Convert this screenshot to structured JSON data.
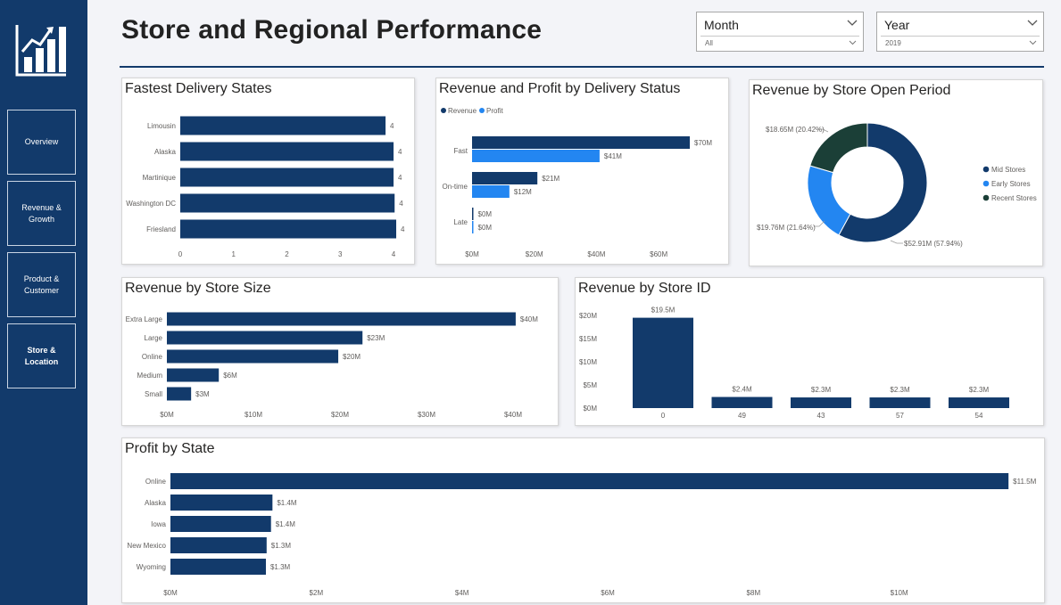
{
  "page": {
    "title": "Store and Regional Performance"
  },
  "colors": {
    "navy": "#123a6b",
    "blue": "#2386f1",
    "dark_green": "#1b3f37",
    "sidebar": "#123a6b"
  },
  "sidebar": {
    "logo_icon": "bar-chart-growth-icon",
    "items": [
      {
        "label": "Overview",
        "active": false
      },
      {
        "label": "Revenue & Growth",
        "active": false
      },
      {
        "label": "Product & Customer",
        "active": false
      },
      {
        "label": "Store & Location",
        "active": true
      }
    ]
  },
  "slicers": {
    "month": {
      "label": "Month",
      "value": "All"
    },
    "year": {
      "label": "Year",
      "value": "2019"
    }
  },
  "chart_data": [
    {
      "id": "fastest_delivery",
      "type": "bar",
      "orientation": "horizontal",
      "title": "Fastest Delivery States",
      "categories": [
        "Limousin",
        "Alaska",
        "Martinique",
        "Washington DC",
        "Friesland"
      ],
      "values": [
        3.85,
        4.0,
        4.0,
        4.02,
        4.05
      ],
      "data_labels": [
        "4",
        "4",
        "4",
        "4",
        "4"
      ],
      "xlim": [
        0,
        4.1
      ],
      "x_ticks": [
        "0",
        "1",
        "2",
        "3",
        "4"
      ]
    },
    {
      "id": "delivery_status",
      "type": "bar",
      "orientation": "horizontal",
      "title": "Revenue and Profit by Delivery Status",
      "categories": [
        "Fast",
        "On-time",
        "Late"
      ],
      "series": [
        {
          "name": "Revenue",
          "values": [
            70,
            21,
            0.3
          ],
          "data_labels": [
            "$70M",
            "$21M",
            "$0M"
          ]
        },
        {
          "name": "Profit",
          "values": [
            41,
            12,
            0.1
          ],
          "data_labels": [
            "$41M",
            "$12M",
            "$0M"
          ]
        }
      ],
      "legend": "top-left",
      "xlim": [
        0,
        70
      ],
      "x_ticks": [
        "$0M",
        "$20M",
        "$40M",
        "$60M"
      ]
    },
    {
      "id": "store_open_period",
      "type": "pie",
      "donut": true,
      "title": "Revenue by Store Open Period",
      "categories": [
        "Mid Stores",
        "Early Stores",
        "Recent Stores"
      ],
      "values": [
        52.91,
        19.76,
        18.65
      ],
      "data_labels": [
        "$52.91M (57.94%)",
        "$19.76M (21.64%)",
        "$18.65M (20.42%)"
      ],
      "legend": "right"
    },
    {
      "id": "store_size",
      "type": "bar",
      "orientation": "horizontal",
      "title": "Revenue by Store Size",
      "categories": [
        "Extra Large",
        "Large",
        "Online",
        "Medium",
        "Small"
      ],
      "values": [
        40.3,
        22.6,
        19.8,
        6,
        2.8
      ],
      "data_labels": [
        "$40M",
        "$23M",
        "$20M",
        "$6M",
        "$3M"
      ],
      "xlim": [
        0,
        40
      ],
      "x_ticks": [
        "$0M",
        "$10M",
        "$20M",
        "$30M",
        "$40M"
      ]
    },
    {
      "id": "store_id",
      "type": "bar",
      "orientation": "vertical",
      "title": "Revenue by Store ID",
      "categories": [
        "0",
        "49",
        "43",
        "57",
        "54"
      ],
      "values": [
        19.5,
        2.4,
        2.3,
        2.3,
        2.3
      ],
      "data_labels": [
        "$19.5M",
        "$2.4M",
        "$2.3M",
        "$2.3M",
        "$2.3M"
      ],
      "ylim": [
        0,
        20
      ],
      "y_ticks": [
        "$0M",
        "$5M",
        "$10M",
        "$15M",
        "$20M"
      ]
    },
    {
      "id": "profit_by_state",
      "type": "bar",
      "orientation": "horizontal",
      "title": "Profit by State",
      "categories": [
        "Online",
        "Alaska",
        "Iowa",
        "New Mexico",
        "Wyoming"
      ],
      "values": [
        11.5,
        1.4,
        1.38,
        1.32,
        1.31
      ],
      "data_labels": [
        "$11.5M",
        "$1.4M",
        "$1.4M",
        "$1.3M",
        "$1.3M"
      ],
      "xlim": [
        0,
        12
      ],
      "x_ticks": [
        "$0M",
        "$2M",
        "$4M",
        "$6M",
        "$8M",
        "$10M"
      ]
    }
  ]
}
